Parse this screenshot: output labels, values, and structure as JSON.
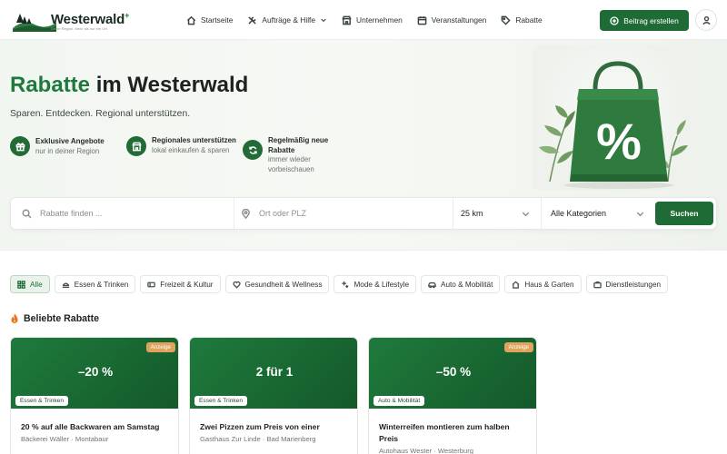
{
  "header": {
    "logo_name": "Westerwald",
    "logo_plus": "+",
    "logo_tagline": "Deine Region. Mehr als nur ein Ort.",
    "nav": [
      {
        "label": "Startseite",
        "icon": "home-icon"
      },
      {
        "label": "Aufträge & Hilfe",
        "icon": "tools-icon"
      },
      {
        "label": "Unternehmen",
        "icon": "store-icon"
      },
      {
        "label": "Veranstaltungen",
        "icon": "calendar-icon"
      },
      {
        "label": "Rabatte",
        "icon": "tag-icon"
      }
    ],
    "create_button": "Beitrag erstellen"
  },
  "hero": {
    "title_accent": "Rabatte",
    "title_rest": " im Westerwald",
    "subtitle": "Sparen. Entdecken. Regional unterstützen.",
    "features": [
      {
        "title": "Exklusive Angebote",
        "desc": "nur in deiner Region",
        "icon": "gift-icon"
      },
      {
        "title": "Regionales unterstützen",
        "desc": "lokal einkaufen & sparen",
        "icon": "shop-icon"
      },
      {
        "title": "Regelmäßig neue Rabatte",
        "desc": "immer wieder vorbeischauen",
        "icon": "refresh-icon"
      }
    ]
  },
  "search": {
    "query_placeholder": "Rabatte finden ...",
    "location_placeholder": "Ort oder PLZ",
    "radius": "25 km",
    "category": "Alle Kategorien",
    "button": "Suchen"
  },
  "categories": [
    {
      "label": "Alle",
      "icon": "grid-icon",
      "active": true
    },
    {
      "label": "Essen & Trinken",
      "icon": "food-icon"
    },
    {
      "label": "Freizeit & Kultur",
      "icon": "ticket-icon"
    },
    {
      "label": "Gesundheit & Wellness",
      "icon": "heart-icon"
    },
    {
      "label": "Mode & Lifestyle",
      "icon": "sparkle-icon"
    },
    {
      "label": "Auto & Mobilität",
      "icon": "car-icon"
    },
    {
      "label": "Haus & Garten",
      "icon": "house-icon"
    },
    {
      "label": "Dienstleistungen",
      "icon": "briefcase-icon"
    }
  ],
  "popular": {
    "title": "Beliebte Rabatte",
    "cards": [
      {
        "value": "–20 %",
        "ad": "Anzeige",
        "category": "Essen & Trinken",
        "title": "20 % auf alle Backwaren am Samstag",
        "meta": "Bäckerei Wäller · Montabaur"
      },
      {
        "value": "2 für 1",
        "ad": "",
        "category": "Essen & Trinken",
        "title": "Zwei Pizzen zum Preis von einer",
        "meta": "Gasthaus Zur Linde · Bad Marienberg"
      },
      {
        "value": "–50 %",
        "ad": "Anzeige",
        "category": "Auto & Mobilität",
        "title": "Winterreifen montieren zum halben Preis",
        "meta": "Autohaus Wester · Westerburg"
      }
    ]
  },
  "colors": {
    "brand": "#1e6b35",
    "accent": "#1e7a3c",
    "ad_badge": "#e0a35b"
  }
}
